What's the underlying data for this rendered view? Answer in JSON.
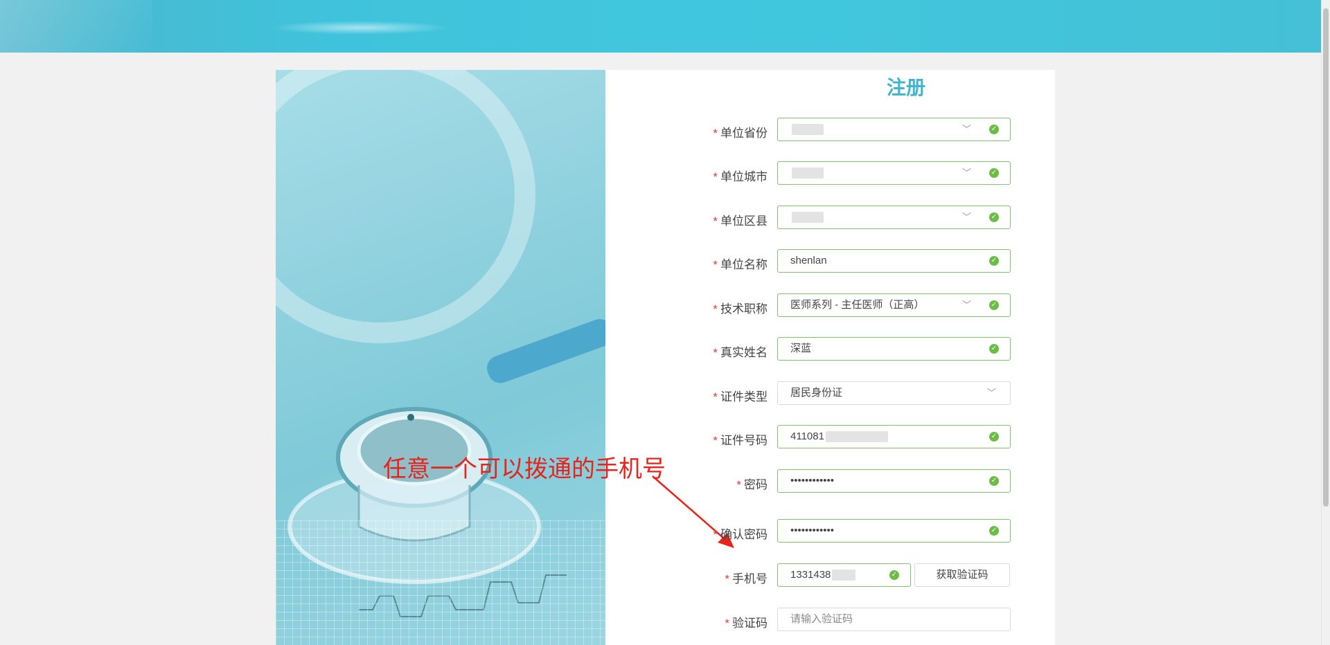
{
  "form": {
    "title": "注册",
    "required_mark": "*",
    "fields": [
      {
        "label": "单位省份",
        "value": "",
        "type": "select",
        "status": "valid"
      },
      {
        "label": "单位城市",
        "value": "",
        "type": "select",
        "status": "valid"
      },
      {
        "label": "单位区县",
        "value": "",
        "type": "select",
        "status": "valid"
      },
      {
        "label": "单位名称",
        "value": "shenlan",
        "type": "text",
        "status": "valid"
      },
      {
        "label": "技术职称",
        "value": "医师系列 - 主任医师（正高）",
        "type": "select",
        "status": "valid"
      },
      {
        "label": "真实姓名",
        "value": "深蓝",
        "type": "text",
        "status": "valid"
      },
      {
        "label": "证件类型",
        "value": "居民身份证",
        "type": "select",
        "status": "neutral"
      },
      {
        "label": "证件号码",
        "value": "411081",
        "type": "text",
        "status": "valid"
      },
      {
        "label": "密码",
        "value": "••••••••••••",
        "type": "password",
        "status": "valid"
      },
      {
        "label": "确认密码",
        "value": "••••••••••••",
        "type": "password",
        "status": "valid"
      },
      {
        "label": "手机号",
        "value": "1331438",
        "type": "text",
        "status": "valid"
      },
      {
        "label": "验证码",
        "placeholder": "请输入验证码",
        "type": "text",
        "status": "neutral"
      }
    ],
    "get_code_button": "获取验证码"
  },
  "annotation": {
    "text": "任意一个可以拨通的手机号",
    "color": "#e8231b"
  },
  "colors": {
    "header": "#40c7de",
    "title": "#3fb5cf",
    "valid_border": "#7cc36a",
    "valid_icon": "#6cbd45",
    "required": "#e03a3a"
  },
  "icons": {
    "valid": "check-circle-icon",
    "dropdown": "chevron-down-icon"
  }
}
